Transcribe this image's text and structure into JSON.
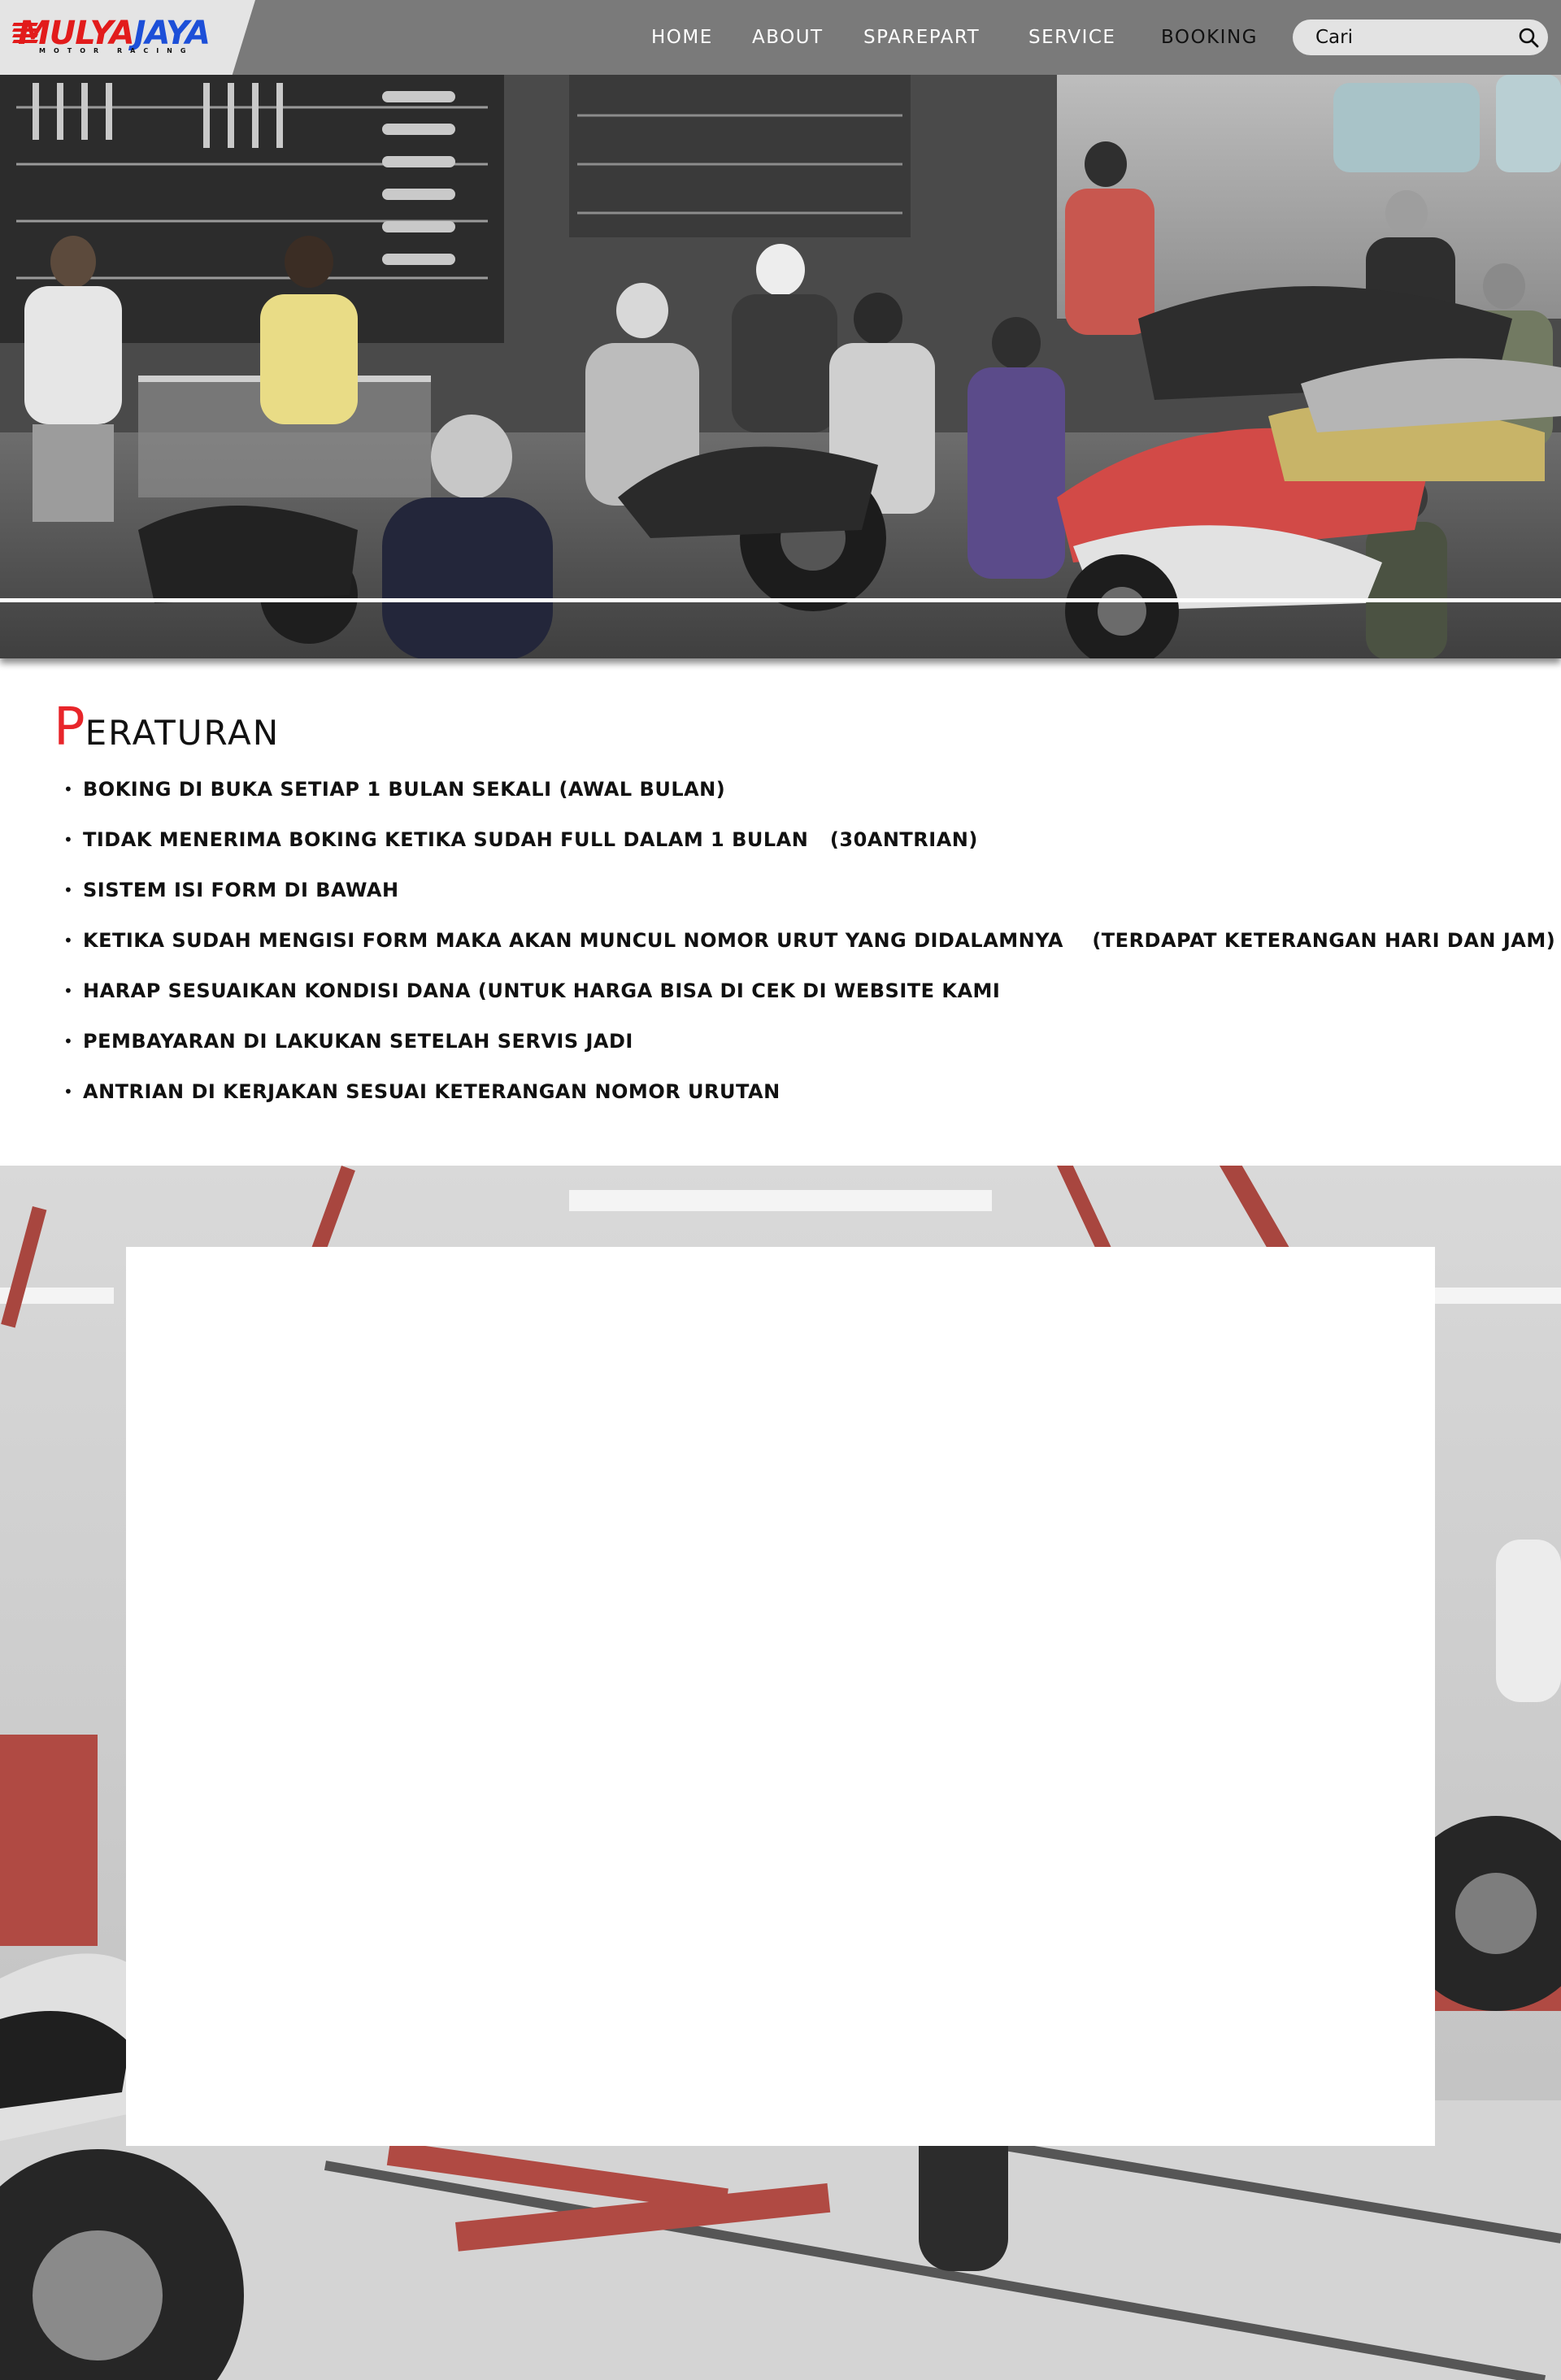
{
  "brand": {
    "name_part1": "MULYA",
    "name_part2": "JAYA",
    "subtitle": "MOTOR RACING",
    "accent_red": "#e21b1b",
    "accent_blue": "#1c4fd8"
  },
  "nav": {
    "items": [
      {
        "label": "HOME"
      },
      {
        "label": "ABOUT"
      },
      {
        "label": "SPAREPART"
      },
      {
        "label": "SERVICE"
      },
      {
        "label": "BOOKING",
        "active": true
      }
    ]
  },
  "search": {
    "placeholder": "Cari",
    "icon": "search-icon"
  },
  "hero": {
    "image": "photo of crowded motorcycle parts shop with customers and parked motorbikes"
  },
  "rules": {
    "title_first": "P",
    "title_rest": "ERATURAN",
    "title_color": "#e8252a",
    "items": [
      "BOKING DI BUKA SETIAP 1 BULAN SEKALI (AWAL BULAN)",
      "TIDAK MENERIMA BOKING KETIKA SUDAH FULL DALAM 1 BULAN   (30ANTRIAN)",
      "SISTEM ISI FORM DI BAWAH",
      "KETIKA SUDAH MENGISI FORM MAKA AKAN MUNCUL NOMOR URUT YANG DIDALAMNYA    (TERDAPAT KETERANGAN HARI DAN JAM)",
      "HARAP SESUAIKAN KONDISI DANA (UNTUK HARGA BISA DI CEK DI WEBSITE KAMI",
      "PEMBAYARAN DI LAKUKAN SETELAH SERVIS JADI",
      "ANTRIAN DI KERJAKAN SESUAI KETERANGAN NOMOR URUTAN"
    ]
  },
  "booking": {
    "background": "photo of motorcycle workshop with red lifts",
    "form_panel": ""
  }
}
